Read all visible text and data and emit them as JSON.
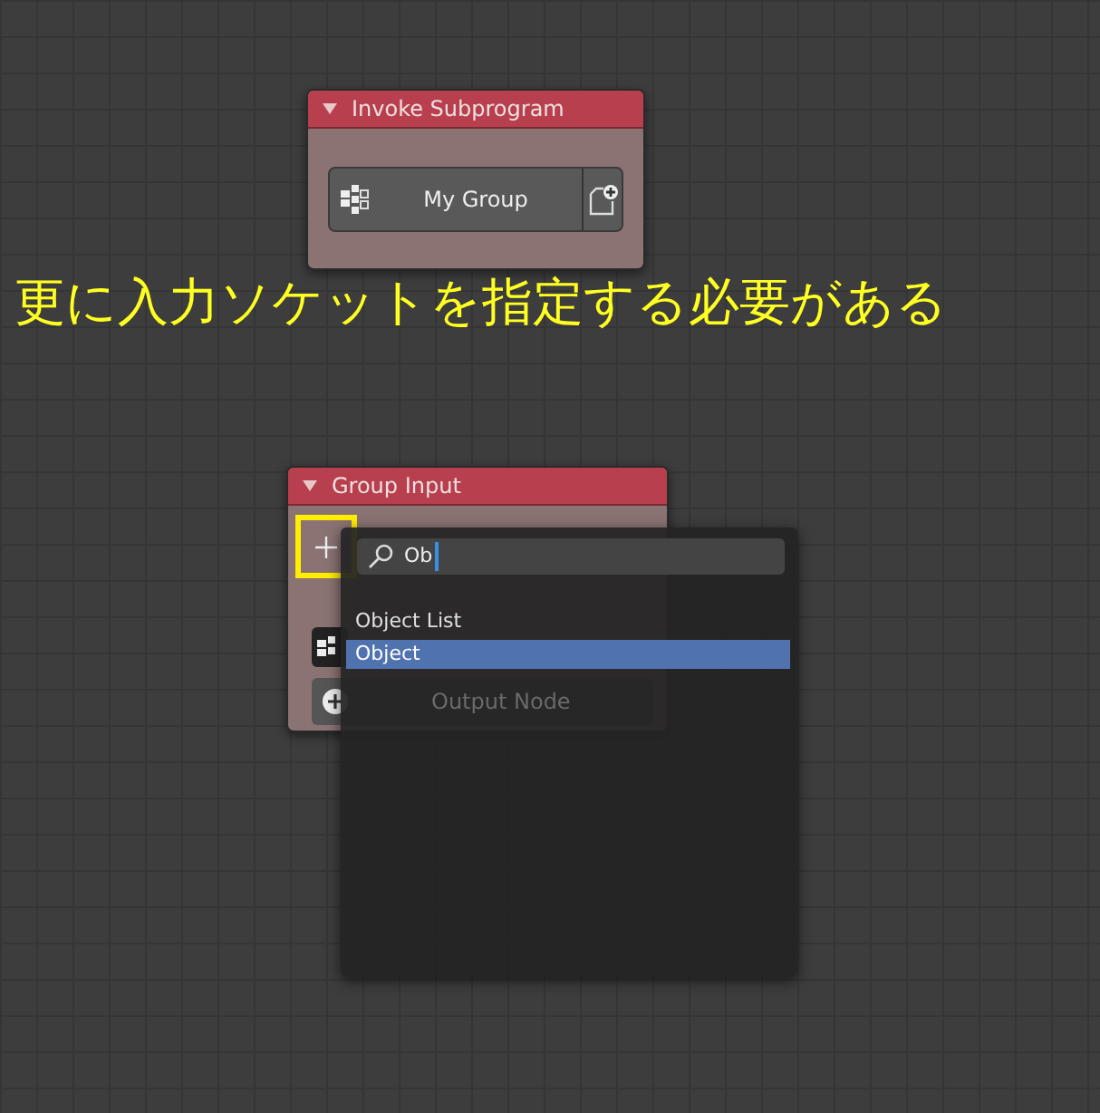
{
  "nodes": [
    {
      "title": "Invoke Subprogram",
      "expanded": true,
      "group_field": {
        "value": "My Group"
      }
    },
    {
      "title": "Group Input",
      "expanded": true,
      "output_button": "Output Node"
    }
  ],
  "annotation": "更に入力ソケットを指定する必要がある",
  "search_popup": {
    "query": "Ob",
    "results": [
      {
        "label": "Object List",
        "selected": false
      },
      {
        "label": "Object",
        "selected": true
      }
    ]
  }
}
